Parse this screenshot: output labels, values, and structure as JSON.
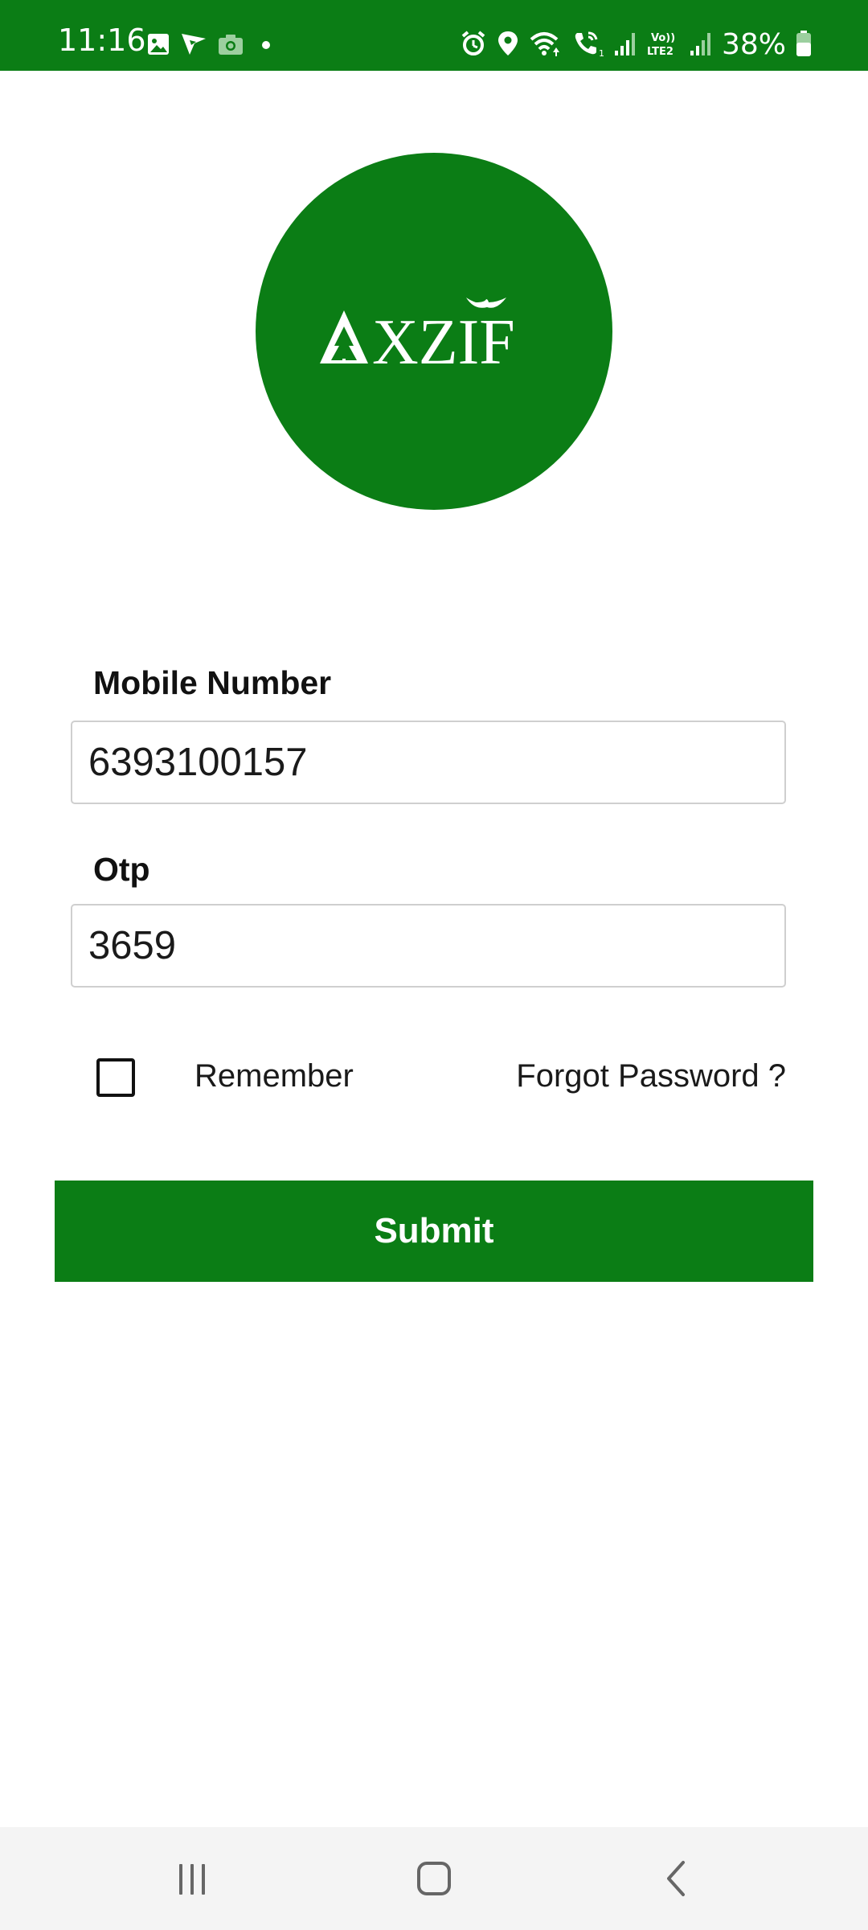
{
  "status_bar": {
    "time": "11:16",
    "battery": "38%",
    "left_icons": [
      "gallery-icon",
      "navigation-flag-icon",
      "camera-icon",
      "dot-icon"
    ],
    "right_icons": [
      "alarm-icon",
      "location-icon",
      "wifi-icon",
      "wifi-call-icon",
      "signal-icon",
      "volte-lte2-icon",
      "signal-icon",
      "battery-icon"
    ],
    "volte_label": "Vo)) LTE2"
  },
  "logo": {
    "text": "AXZIF"
  },
  "form": {
    "mobile_label": "Mobile Number",
    "mobile_value": "6393100157",
    "otp_label": "Otp",
    "otp_value": "3659",
    "remember_label": "Remember",
    "remember_checked": false,
    "forgot_label": "Forgot Password ?",
    "submit_label": "Submit"
  },
  "nav": {
    "buttons": [
      "recents-icon",
      "home-icon",
      "back-icon"
    ]
  },
  "colors": {
    "primary": "#0b7d15",
    "text": "#111111",
    "input_border": "#cfcfcf",
    "nav_bg": "#f4f4f4"
  }
}
